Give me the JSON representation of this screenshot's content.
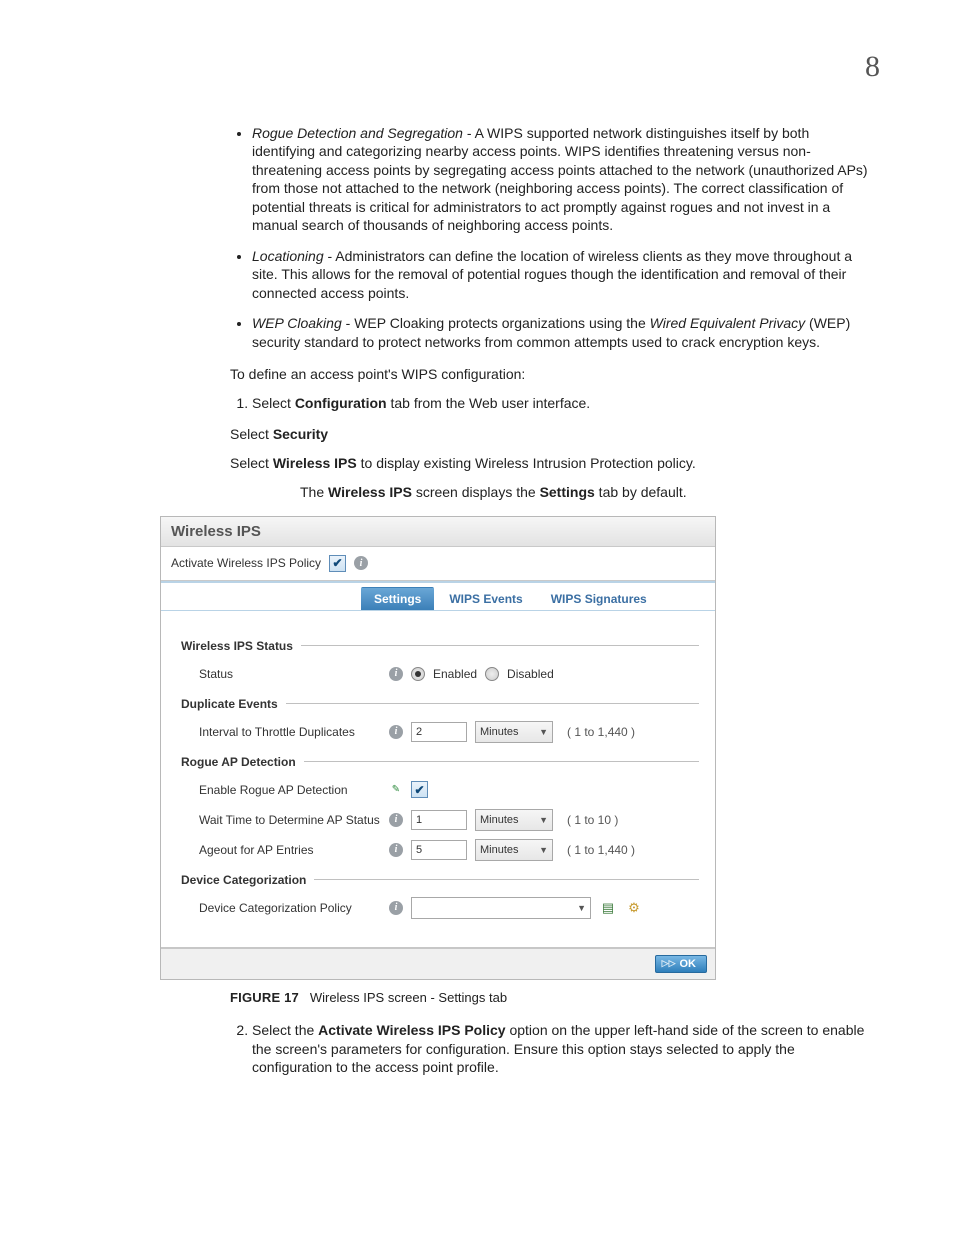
{
  "page_number": "8",
  "bullets": [
    {
      "term": "Rogue Detection and Segregation",
      "text": " - A WIPS supported network distinguishes itself by both identifying and categorizing nearby access points. WIPS identifies threatening versus non-threatening access points by segregating access points attached to the network (unauthorized APs) from those not attached to the network (neighboring access points). The correct classification of potential threats is critical for administrators to act promptly against rogues and not invest in a manual search of thousands of neighboring access points."
    },
    {
      "term": "Locationing",
      "text": " - Administrators can define the location of wireless clients as they move throughout a site. This allows for the removal of potential rogues though the identification and removal of their connected access points."
    },
    {
      "term": "WEP Cloaking",
      "text_prefix": " - WEP Cloaking protects organizations using the ",
      "term2": "Wired Equivalent Privacy",
      "text_suffix": " (WEP) security standard to protect networks from common attempts used to crack encryption keys."
    }
  ],
  "intro": "To define an access point's WIPS configuration:",
  "step1_pre": "Select ",
  "step1_bold": "Configuration",
  "step1_post": " tab from the Web user interface.",
  "selsec_pre": "Select ",
  "selsec_bold": "Security",
  "selwips_pre": "Select ",
  "selwips_bold": "Wireless IPS",
  "selwips_post": " to display existing Wireless Intrusion Protection policy.",
  "display_pre": "The ",
  "display_b1": "Wireless IPS",
  "display_mid": " screen displays the ",
  "display_b2": "Settings",
  "display_post": " tab by default.",
  "ui": {
    "title": "Wireless IPS",
    "activate_label": "Activate Wireless IPS Policy",
    "tabs": {
      "settings": "Settings",
      "events": "WIPS Events",
      "signatures": "WIPS Signatures"
    },
    "g_status": "Wireless IPS Status",
    "f_status": "Status",
    "r_enabled": "Enabled",
    "r_disabled": "Disabled",
    "g_dup": "Duplicate Events",
    "f_interval": "Interval to Throttle Duplicates",
    "v_interval": "2",
    "u_minutes": "Minutes",
    "range_int": "( 1 to 1,440 )",
    "g_rogue": "Rogue AP Detection",
    "f_enable_rogue": "Enable Rogue AP Detection",
    "f_wait": "Wait Time to Determine AP Status",
    "v_wait": "1",
    "range_wait": "( 1 to 10 )",
    "f_ageout": "Ageout for AP Entries",
    "v_ageout": "5",
    "range_ageout": "( 1 to 1,440 )",
    "g_devcat": "Device Categorization",
    "f_devcat": "Device Categorization Policy",
    "ok": "OK"
  },
  "fig_label": "FIGURE 17",
  "fig_caption": "Wireless IPS screen - Settings tab",
  "step2_pre": "Select the ",
  "step2_bold": "Activate Wireless IPS Policy",
  "step2_post": " option on the upper left-hand side of the screen to enable the screen's parameters for configuration. Ensure this option stays selected to apply the configuration to the access point profile."
}
